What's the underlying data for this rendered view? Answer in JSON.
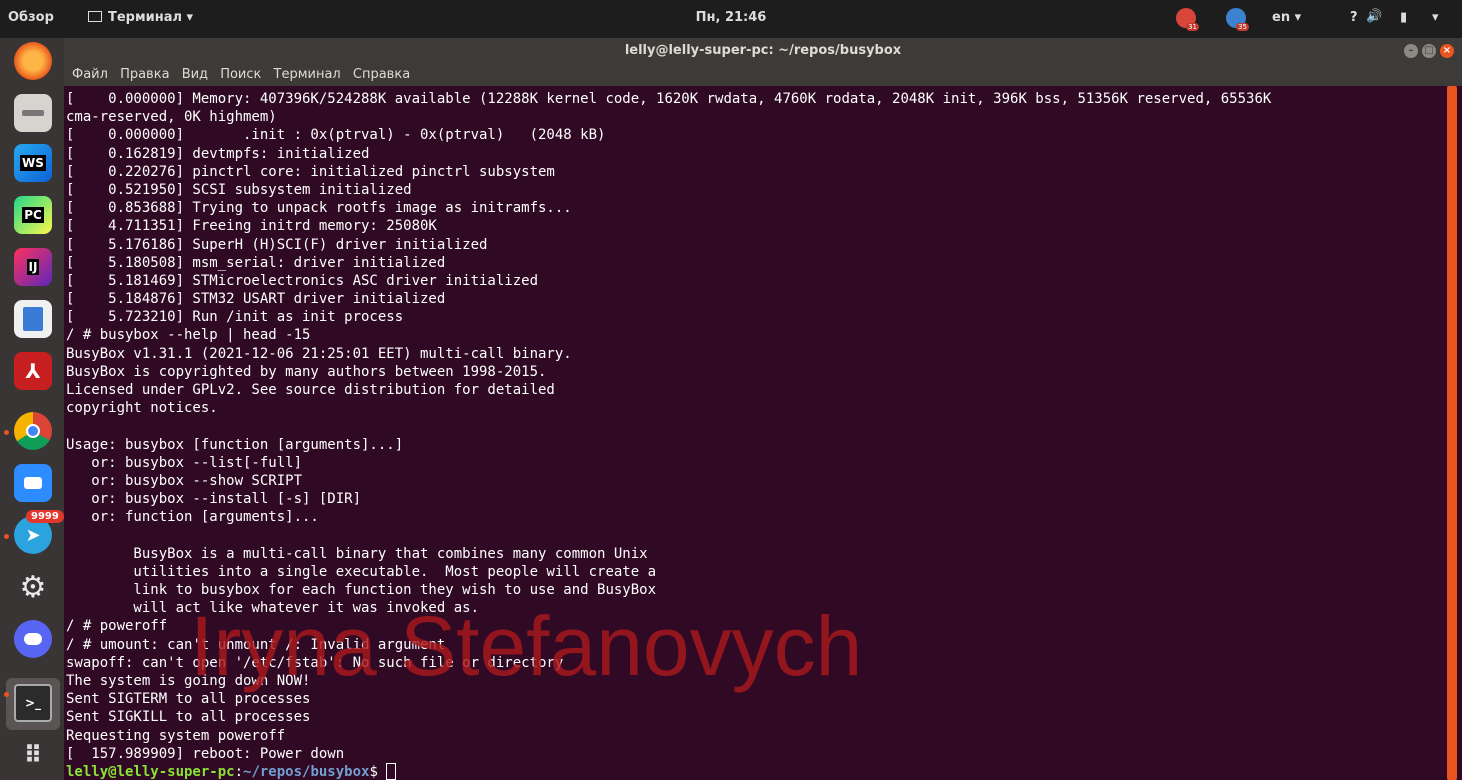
{
  "topbar": {
    "activities": "Обзор",
    "app_menu": "Терминал ▾",
    "clock": "Пн, 21:46",
    "lang": "en ▾",
    "tray_badge_1": "31",
    "tray_badge_2": "35",
    "help": "?",
    "sound": "🔊",
    "battery": "▮",
    "system_menu": "▾"
  },
  "dock": {
    "ws": "WS",
    "pc": "PC",
    "ij": "IJ",
    "telegram_badge": "9999",
    "terminal": ">_",
    "apps": "⠿"
  },
  "window": {
    "title": "lelly@lelly-super-pc: ~/repos/busybox",
    "menu": [
      "Файл",
      "Правка",
      "Вид",
      "Поиск",
      "Терминал",
      "Справка"
    ]
  },
  "terminal": {
    "lines": [
      "[    0.000000] Memory: 407396K/524288K available (12288K kernel code, 1620K rwdata, 4760K rodata, 2048K init, 396K bss, 51356K reserved, 65536K",
      "cma-reserved, 0K highmem)",
      "[    0.000000]       .init : 0x(ptrval) - 0x(ptrval)   (2048 kB)",
      "[    0.162819] devtmpfs: initialized",
      "[    0.220276] pinctrl core: initialized pinctrl subsystem",
      "[    0.521950] SCSI subsystem initialized",
      "[    0.853688] Trying to unpack rootfs image as initramfs...",
      "[    4.711351] Freeing initrd memory: 25080K",
      "[    5.176186] SuperH (H)SCI(F) driver initialized",
      "[    5.180508] msm_serial: driver initialized",
      "[    5.181469] STMicroelectronics ASC driver initialized",
      "[    5.184876] STM32 USART driver initialized",
      "[    5.723210] Run /init as init process",
      "/ # busybox --help | head -15",
      "BusyBox v1.31.1 (2021-12-06 21:25:01 EET) multi-call binary.",
      "BusyBox is copyrighted by many authors between 1998-2015.",
      "Licensed under GPLv2. See source distribution for detailed",
      "copyright notices.",
      "",
      "Usage: busybox [function [arguments]...]",
      "   or: busybox --list[-full]",
      "   or: busybox --show SCRIPT",
      "   or: busybox --install [-s] [DIR]",
      "   or: function [arguments]...",
      "",
      "        BusyBox is a multi-call binary that combines many common Unix",
      "        utilities into a single executable.  Most people will create a",
      "        link to busybox for each function they wish to use and BusyBox",
      "        will act like whatever it was invoked as.",
      "/ # poweroff",
      "/ # umount: can't unmount /: Invalid argument",
      "swapoff: can't open '/etc/fstab': No such file or directory",
      "The system is going down NOW!",
      "Sent SIGTERM to all processes",
      "Sent SIGKILL to all processes",
      "Requesting system poweroff",
      "[  157.989909] reboot: Power down"
    ],
    "prompt_user": "lelly@lelly-super-pc",
    "prompt_sep": ":",
    "prompt_path": "~/repos/busybox",
    "prompt_suffix": "$ "
  },
  "watermark": "Iryna Stefanovych",
  "colors": {
    "terminal_bg": "#300a24",
    "accent": "#e9541f",
    "prompt_user": "#8ae234",
    "prompt_path": "#729fcf"
  }
}
